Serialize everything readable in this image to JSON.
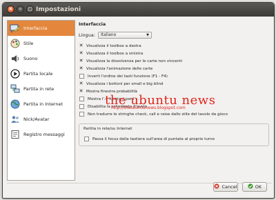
{
  "window": {
    "title": "Impostazioni",
    "close_glyph": "×",
    "minimize_glyph": "–",
    "maximize_glyph": "□"
  },
  "sidebar": {
    "items": [
      {
        "label": "Interfaccia",
        "icon": "interface-icon",
        "active": true
      },
      {
        "label": "Stile",
        "icon": "style-icon"
      },
      {
        "label": "Suono",
        "icon": "sound-icon"
      },
      {
        "label": "Partita locale",
        "icon": "play-icon"
      },
      {
        "label": "Partita in rete",
        "icon": "network-game-icon"
      },
      {
        "label": "Partita in Internet",
        "icon": "globe-icon"
      },
      {
        "label": "Nick/Avatar",
        "icon": "users-icon"
      },
      {
        "label": "Registro messaggi",
        "icon": "message-log-icon"
      }
    ]
  },
  "content": {
    "heading": "Interfaccia",
    "language_label": "Lingua:",
    "language_value": "Italiano",
    "options": [
      {
        "label": "Visualizza il toolbox a destra",
        "checked": true
      },
      {
        "label": "Visualizza il toolbox a sinistra",
        "checked": true
      },
      {
        "label": "Visualizza la dissolvenza per le carte non vincenti",
        "checked": true
      },
      {
        "label": "Visualizza l'animazione delle carte",
        "checked": true
      },
      {
        "label": "Inverti l'ordine dei tasti funzione (F1 - F4)",
        "checked": false
      },
      {
        "label": "Visualizza i bottoni per small e big blind",
        "checked": true
      },
      {
        "label": "Mostra finestra probabilità",
        "checked": true
      },
      {
        "label": "Mostra l'... funzioni per l'...",
        "checked": false
      },
      {
        "label": "Disabilita la schermata d'avvio",
        "checked": false
      },
      {
        "label": "Non tradurre le stringhe check, call e raise dallo stile del tavolo da gioco",
        "checked": false
      }
    ],
    "group": {
      "title": "Partita in rete/su Internet",
      "option": {
        "label": "Passa il focus della tastiera sull'area di puntata al proprio turno",
        "checked": false
      }
    }
  },
  "watermark": {
    "title": "the ubuntu news",
    "url": "http://theubuntunews.blogspot.com"
  },
  "buttons": {
    "cancel": "Cancel",
    "ok": "OK"
  },
  "colors": {
    "accent": "#e4873d",
    "titlebar": "#3c3b37",
    "watermark": "#e0251c"
  }
}
